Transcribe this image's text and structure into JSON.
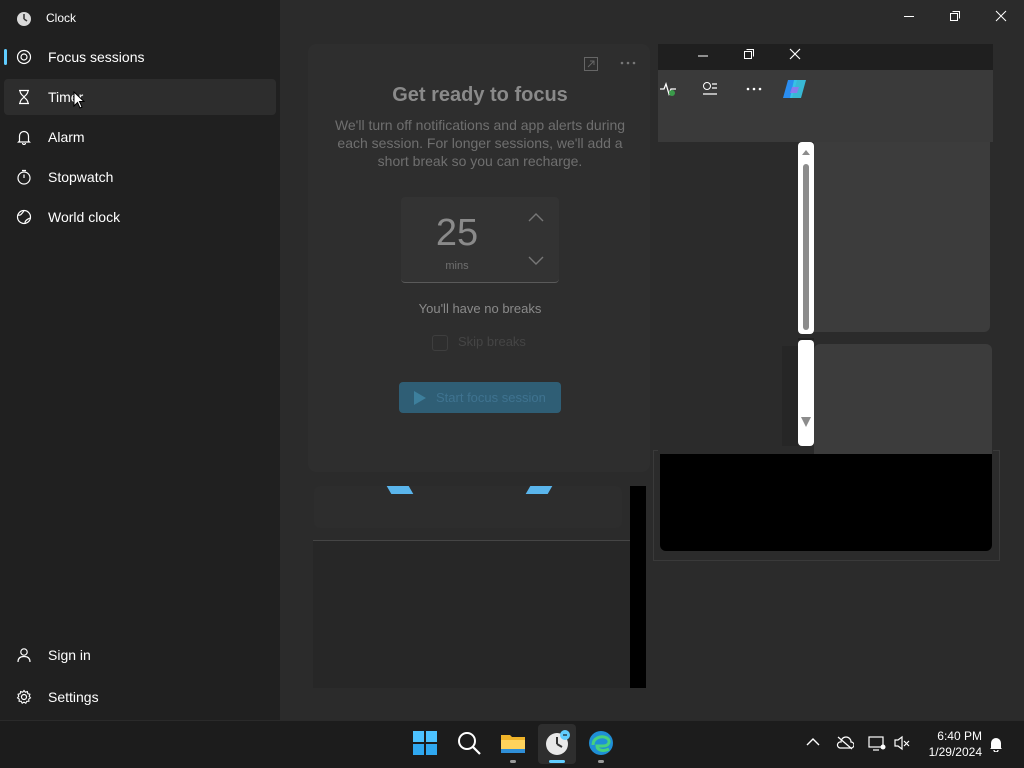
{
  "window": {
    "title": "Clock",
    "controls": [
      "minimize",
      "maximize",
      "close"
    ]
  },
  "sidebar": {
    "items": [
      {
        "label": "Focus sessions",
        "icon": "focus-icon"
      },
      {
        "label": "Timer",
        "icon": "hourglass-icon"
      },
      {
        "label": "Alarm",
        "icon": "bell-icon"
      },
      {
        "label": "Stopwatch",
        "icon": "stopwatch-icon"
      },
      {
        "label": "World clock",
        "icon": "globe-icon"
      }
    ],
    "footer": [
      {
        "label": "Sign in",
        "icon": "person-icon"
      },
      {
        "label": "Settings",
        "icon": "gear-icon"
      }
    ]
  },
  "focus": {
    "title": "Get ready to focus",
    "description": "We'll turn off notifications and app alerts during each session. For longer sessions, we'll add a short break so you can recharge.",
    "timer_value": "25",
    "timer_unit": "mins",
    "breaks_text": "You'll have no breaks",
    "skip_label": "Skip breaks",
    "start_label": "Start focus session"
  },
  "taskbar": {
    "apps": [
      "start-icon",
      "search-icon",
      "file-explorer-icon",
      "clock-app-icon",
      "edge-icon"
    ],
    "tray": [
      "chevron-up-icon",
      "onedrive-icon",
      "network-icon",
      "volume-muted-icon",
      "notification-bell-icon"
    ],
    "time": "6:40 PM",
    "date": "1/29/2024"
  },
  "colors": {
    "accent": "#60cdff",
    "sidebar_bg": "#202020",
    "content_bg": "#2b2b2b"
  }
}
